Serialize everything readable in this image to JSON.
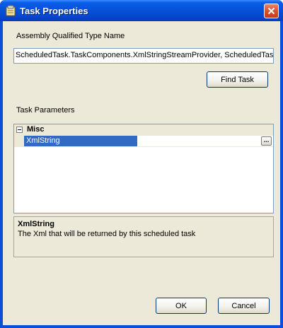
{
  "window": {
    "title": "Task Properties",
    "icon": "task-properties-icon",
    "close_icon": "close-icon"
  },
  "assembly": {
    "label": "Assembly Qualified Type Name",
    "value": "ScheduledTask.TaskComponents.XmlStringStreamProvider, ScheduledTask"
  },
  "buttons": {
    "find_task": "Find Task",
    "ok": "OK",
    "cancel": "Cancel"
  },
  "task_parameters": {
    "label": "Task Parameters",
    "category": "Misc",
    "properties": [
      {
        "name": "XmlString",
        "value": "",
        "selected": true
      }
    ],
    "ellipsis": "..."
  },
  "description": {
    "title": "XmlString",
    "text": "The Xml that will be returned by this scheduled task"
  },
  "colors": {
    "title_bar": "#0752d8",
    "selection": "#316ac5",
    "dialog_bg": "#ece9d8",
    "close_button": "#d9532e"
  }
}
